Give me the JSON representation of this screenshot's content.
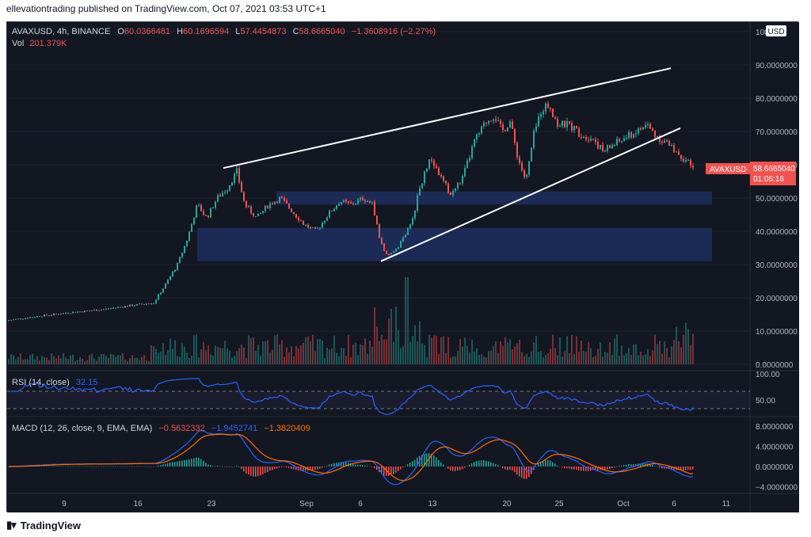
{
  "publisher_line": "ellevationtrading published on TradingView.com, Oct 07, 2021 03:53 UTC+1",
  "footer": {
    "logo_icon": "tradingview-logo-icon",
    "brand": "TradingView"
  },
  "colors": {
    "up": "#26a69a",
    "down": "#ef5350",
    "bg": "#131722",
    "zone": "#1e2f5e",
    "rsi": "#2962ff",
    "macd": "#2962ff",
    "signal": "#ff6d00"
  },
  "legend": {
    "symbol": "AVAXUSD, 4h, BINANCE",
    "open_label": "O",
    "open": "60.0366481",
    "high_label": "H",
    "high": "60.1696594",
    "low_label": "L",
    "low": "57.4454873",
    "close_label": "C",
    "close": "58.6665040",
    "change": "−1.3608916 (−2.27%)",
    "vol_label": "Vol",
    "vol": "201.379K"
  },
  "price_badge": {
    "symbol": "AVAXUSD",
    "price": "58.6665040",
    "countdown": "01:06:16"
  },
  "currency": "USD",
  "rsi_legend": {
    "label": "RSI (14, close)",
    "value": "32.15"
  },
  "macd_legend": {
    "label": "MACD (12, 26, close, 9, EMA, EMA)",
    "v1": "−0.5632332",
    "v2": "−1.9452741",
    "v3": "−1.3820409"
  },
  "chart_data": {
    "type": "candlestick",
    "symbol": "AVAXUSD",
    "interval": "4h",
    "exchange": "BINANCE",
    "x_ticks": [
      "9",
      "16",
      "23",
      "Sep",
      "6",
      "13",
      "20",
      "25",
      "Oct",
      "6",
      "11"
    ],
    "price_axis": {
      "ticks": [
        "100",
        "90.0000000",
        "80.0000000",
        "70.0000000",
        "60.0000000",
        "50.0000000",
        "40.0000000",
        "30.0000000",
        "20.0000000",
        "10.0000000",
        "0.0000000"
      ],
      "ylim": [
        0,
        100
      ]
    },
    "rsi_axis": {
      "ticks": [
        "100.00",
        "50.00"
      ]
    },
    "macd_axis": {
      "ticks": [
        "8.0000000",
        "4.0000000",
        "0.0000000",
        "−4.0000000"
      ],
      "ylim": [
        -4.5,
        8.5
      ]
    },
    "price_path": [
      [
        0,
        13.2
      ],
      [
        40,
        14.5
      ],
      [
        80,
        15.6
      ],
      [
        120,
        16.5
      ],
      [
        160,
        17.8
      ],
      [
        185,
        18.5
      ],
      [
        200,
        24
      ],
      [
        215,
        30
      ],
      [
        228,
        38
      ],
      [
        240,
        48
      ],
      [
        252,
        44
      ],
      [
        265,
        50
      ],
      [
        278,
        53
      ],
      [
        290,
        58
      ],
      [
        300,
        48
      ],
      [
        315,
        44
      ],
      [
        330,
        48
      ],
      [
        345,
        50
      ],
      [
        360,
        46
      ],
      [
        375,
        42
      ],
      [
        390,
        40
      ],
      [
        405,
        45
      ],
      [
        420,
        49
      ],
      [
        435,
        48
      ],
      [
        450,
        50
      ],
      [
        462,
        48
      ],
      [
        470,
        38
      ],
      [
        480,
        32
      ],
      [
        495,
        36
      ],
      [
        510,
        42
      ],
      [
        522,
        54
      ],
      [
        535,
        62
      ],
      [
        548,
        56
      ],
      [
        560,
        51
      ],
      [
        575,
        56
      ],
      [
        590,
        67
      ],
      [
        605,
        73
      ],
      [
        615,
        75
      ],
      [
        625,
        70
      ],
      [
        635,
        73
      ],
      [
        645,
        62
      ],
      [
        655,
        55
      ],
      [
        665,
        69
      ],
      [
        675,
        77
      ],
      [
        685,
        78
      ],
      [
        695,
        72
      ],
      [
        710,
        72
      ],
      [
        725,
        69
      ],
      [
        740,
        68
      ],
      [
        752,
        64
      ],
      [
        765,
        66
      ],
      [
        780,
        68
      ],
      [
        795,
        70
      ],
      [
        808,
        72
      ],
      [
        818,
        69
      ],
      [
        830,
        67
      ],
      [
        845,
        64
      ],
      [
        858,
        61
      ],
      [
        866,
        58.7
      ]
    ],
    "volume": {
      "note": "4h volume bars, peak near Sep 9"
    },
    "zones": [
      {
        "from": 48,
        "to": 52
      },
      {
        "from": 31,
        "to": 41
      }
    ],
    "trendlines": [
      {
        "from": [
          273,
          59
        ],
        "to": [
          838,
          89
        ]
      },
      {
        "from": [
          472,
          31
        ],
        "to": [
          850,
          71
        ]
      }
    ],
    "rsi_last": 32.15,
    "macd_last": {
      "macd": -1.9452741,
      "signal": -1.3820409,
      "hist": -0.5632332
    }
  }
}
